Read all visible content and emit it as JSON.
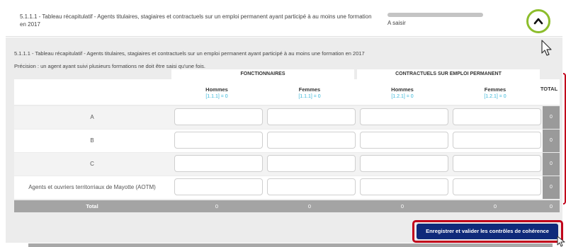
{
  "header": {
    "title": "5.1.1.1 - Tableau récapitulatif - Agents titulaires, stagiaires et contractuels sur un emploi permanent ayant participé à au moins une formation en 2017",
    "status": "A saisir",
    "progress_fraction": 0
  },
  "section": {
    "title": "5.1.1.1 - Tableau récapitulatif - Agents titulaires, stagiaires et contractuels sur un emploi permanent ayant participé à au moins une formation en 2017",
    "precision": "Précision : un agent ayant suivi plusieurs formations ne doit être saisi qu'une fois."
  },
  "table": {
    "groups": [
      "FONCTIONNAIRES",
      "CONTRACTUELS SUR EMPLOI PERMANENT"
    ],
    "columns": [
      {
        "label": "Hommes",
        "ref": "[1.1.1] = 0"
      },
      {
        "label": "Femmes",
        "ref": "[1.1.1] = 0"
      },
      {
        "label": "Hommes",
        "ref": "[1.2.1] = 0"
      },
      {
        "label": "Femmes",
        "ref": "[1.2.1] = 0"
      }
    ],
    "total_header": "TOTAL",
    "rows": [
      {
        "label": "A",
        "values": [
          "",
          "",
          "",
          ""
        ],
        "total": "0"
      },
      {
        "label": "B",
        "values": [
          "",
          "",
          "",
          ""
        ],
        "total": "0"
      },
      {
        "label": "C",
        "values": [
          "",
          "",
          "",
          ""
        ],
        "total": "0"
      },
      {
        "label": "Agents et ouvriers territorriaux de Mayotte (AOTM)",
        "values": [
          "",
          "",
          "",
          ""
        ],
        "total": "0"
      }
    ],
    "totals": {
      "label": "Total",
      "values": [
        "0",
        "0",
        "0",
        "0"
      ],
      "grand_total": "0"
    }
  },
  "actions": {
    "save_label": "Enregistrer et valider les contrôles de cohérence"
  },
  "colors": {
    "accent_green": "#8cbd2c",
    "highlight_red": "#c0001a",
    "button_navy": "#0f2a7a",
    "ref_cyan": "#36b6d8"
  }
}
